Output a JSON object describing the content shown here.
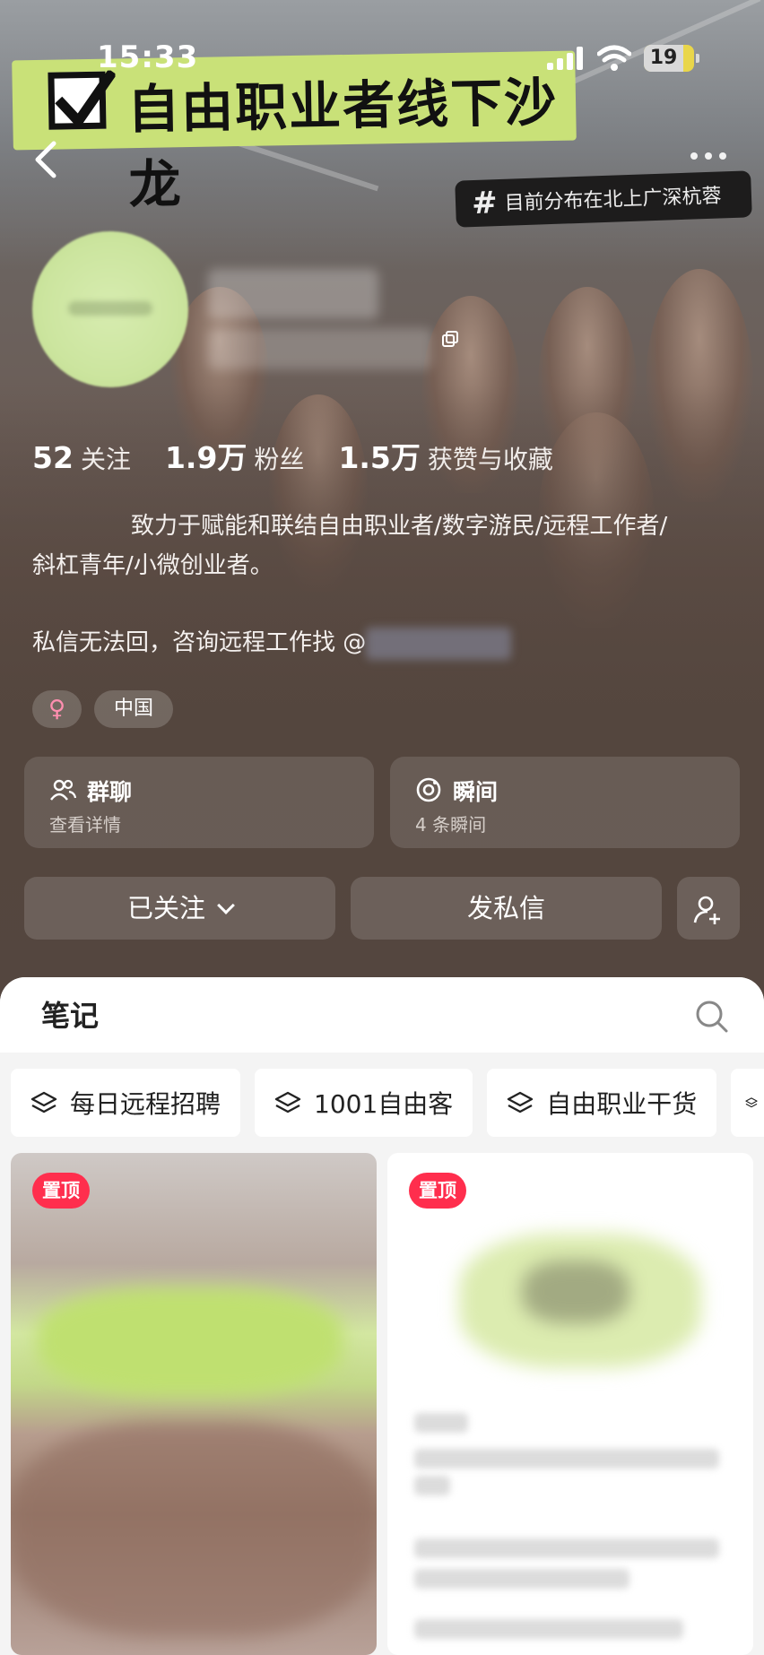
{
  "status_bar": {
    "time": "15:33",
    "battery": "19"
  },
  "banner": {
    "title": "自由职业者线下沙龙",
    "cities_tag": "目前分布在北上广深杭蓉",
    "hash": "#"
  },
  "profile": {
    "stats": [
      {
        "value": "52",
        "label": "关注"
      },
      {
        "value": "1.9万",
        "label": "粉丝"
      },
      {
        "value": "1.5万",
        "label": "获赞与收藏"
      }
    ],
    "bio_line1": "致力于赋能和联结自由职业者/数字游民/远程工作者/",
    "bio_line2": "斜杠青年/小微创业者。",
    "bio_line3": "私信无法回，咨询远程工作找 @",
    "gender_symbol": "♀",
    "region": "中国"
  },
  "cards": {
    "group_chat": {
      "title": "群聊",
      "subtitle": "查看详情",
      "icon": "group-icon"
    },
    "moments": {
      "title": "瞬间",
      "subtitle": "4 条瞬间",
      "icon": "moments-icon"
    }
  },
  "actions": {
    "follow": "已关注",
    "message": "发私信"
  },
  "notes": {
    "tab_title": "笔记",
    "collections": [
      "每日远程招聘",
      "1001自由客",
      "自由职业干货"
    ],
    "pinned_label": "置顶"
  },
  "colors": {
    "banner": "#c9e178",
    "pin": "#ff2e4d"
  }
}
